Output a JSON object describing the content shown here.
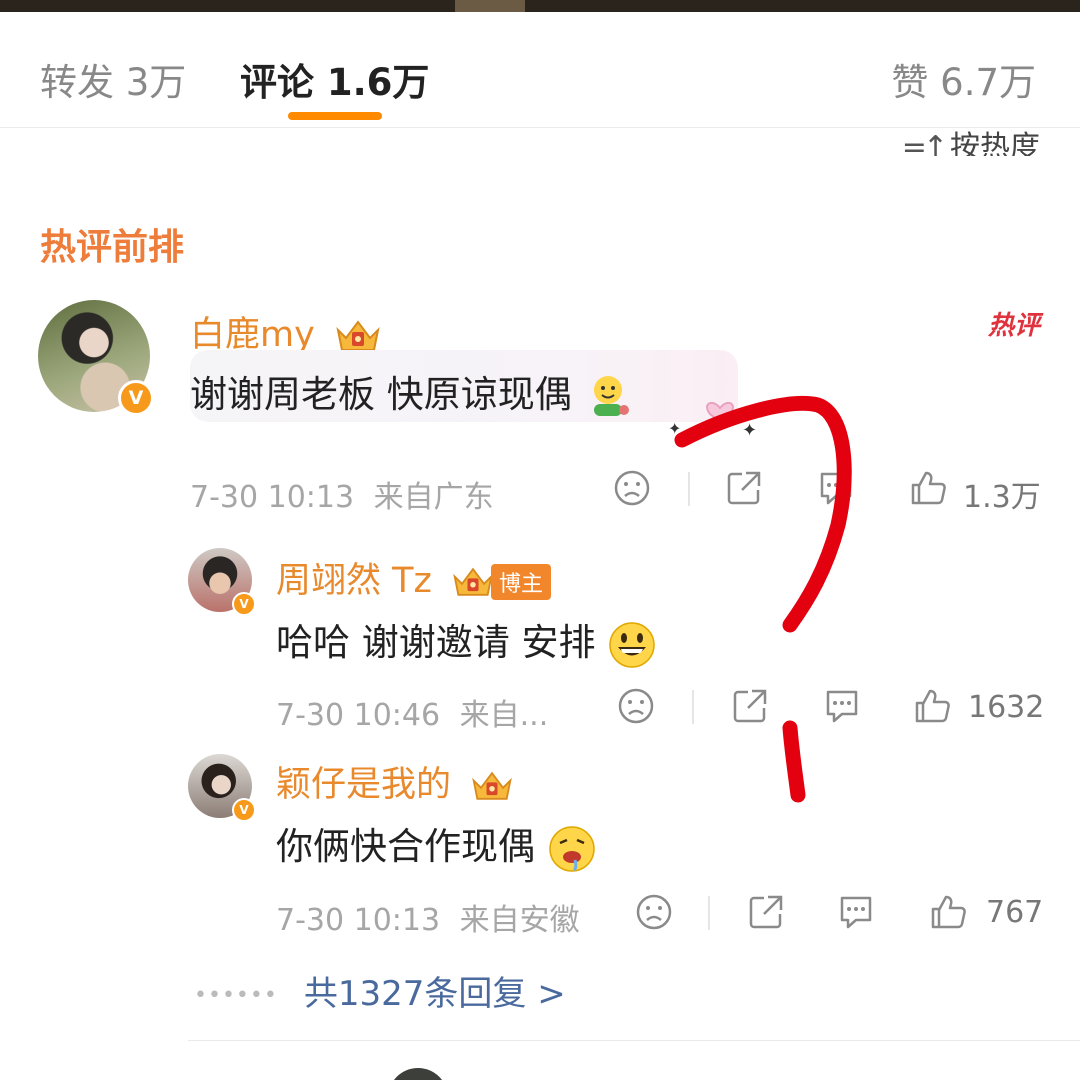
{
  "tabs": {
    "repost": "转发 3万",
    "comment": "评论 1.6万",
    "like": "赞 6.7万"
  },
  "sort_label": "按热度",
  "section_title": "热评前排",
  "hot_tag": "热评",
  "accent_color": "#ff8a00",
  "name_color": "#e8892c",
  "comments": [
    {
      "name": "白鹿my",
      "text": "谢谢周老板 快原谅现偶",
      "time": "7-30 10:13",
      "location": "来自广东",
      "likes": "1.3万"
    }
  ],
  "replies": [
    {
      "name": "周翊然 Tz",
      "badge": "博主",
      "text": "哈哈 谢谢邀请 安排",
      "time": "7-30 10:46",
      "location": "来自...",
      "likes": "1632"
    },
    {
      "name": "颖仔是我的",
      "text": "你俩快合作现偶",
      "time": "7-30 10:13",
      "location": "来自安徽",
      "likes": "767"
    }
  ],
  "more_replies": "共1327条回复 >",
  "icons": [
    "sad-face-icon",
    "share-icon",
    "comment-bubble-icon",
    "thumbs-up-icon",
    "crown-badge-icon",
    "verified-v-icon",
    "sort-icon"
  ]
}
